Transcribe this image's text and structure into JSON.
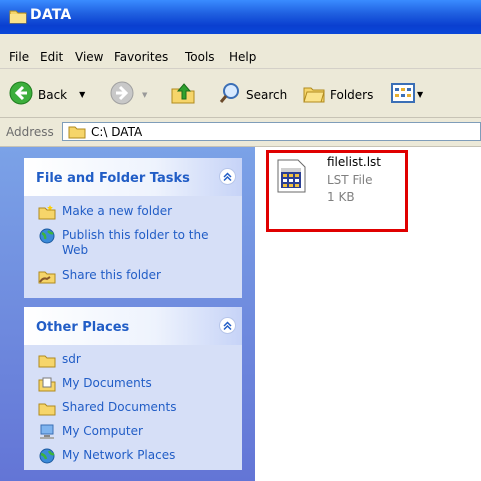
{
  "window": {
    "title": "DATA"
  },
  "menu": [
    "File",
    "Edit",
    "View",
    "Favorites",
    "Tools",
    "Help"
  ],
  "toolbar": {
    "back": "Back",
    "search": "Search",
    "folders": "Folders"
  },
  "address": {
    "label": "Address",
    "path": "C:\\ DATA"
  },
  "file_tasks": {
    "title": "File and Folder Tasks",
    "items": [
      {
        "label": "Make a new folder",
        "icon": "new-folder-icon"
      },
      {
        "label": "Publish this folder to the Web",
        "icon": "publish-web-icon"
      },
      {
        "label": "Share this folder",
        "icon": "share-folder-icon"
      }
    ]
  },
  "other_places": {
    "title": "Other Places",
    "items": [
      {
        "label": "sdr",
        "icon": "folder-icon"
      },
      {
        "label": "My Documents",
        "icon": "my-documents-icon"
      },
      {
        "label": "Shared Documents",
        "icon": "folder-icon"
      },
      {
        "label": "My Computer",
        "icon": "my-computer-icon"
      },
      {
        "label": "My Network Places",
        "icon": "network-places-icon"
      }
    ]
  },
  "file": {
    "name": "filelist.lst",
    "type": "LST File",
    "size": "1 KB",
    "icon": "lst-file-icon"
  },
  "colors": {
    "title_bar": "#1f5fe0",
    "task_link": "#215dc6",
    "highlight_border": "#e00000"
  }
}
